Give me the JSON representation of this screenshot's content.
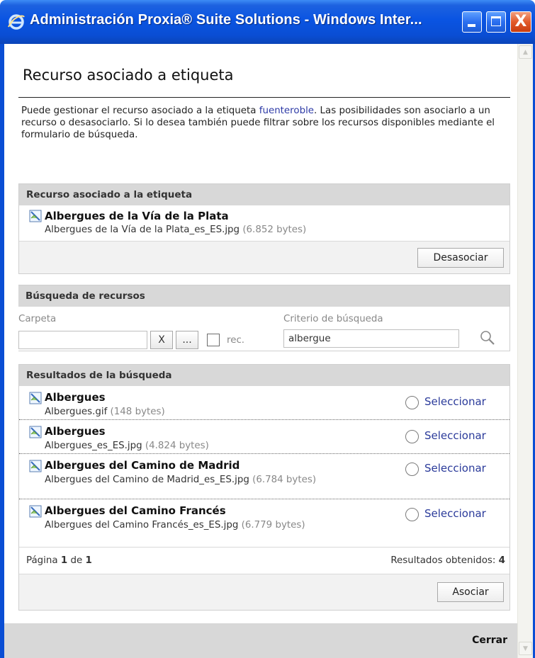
{
  "window": {
    "title": "Administración Proxia® Suite Solutions - Windows Inter...",
    "close_glyph": "X"
  },
  "page": {
    "heading": "Recurso asociado a etiqueta",
    "intro_prefix": "Puede gestionar el recurso asociado a la etiqueta ",
    "intro_tag": "fuenteroble",
    "intro_suffix": ". Las posibilidades son asociarlo a un recurso o desasociarlo. Si lo desea también puede filtrar sobre los recursos disponibles mediante el formulario de búsqueda."
  },
  "associated": {
    "header": "Recurso asociado a la etiqueta",
    "title": "Albergues de la Vía de la Plata",
    "filename": "Albergues de la Vía de la Plata_es_ES.jpg",
    "size": "(6.852 bytes)",
    "icon": "image-file-icon",
    "button": "Desasociar"
  },
  "search": {
    "header": "Búsqueda de recursos",
    "folder_label": "Carpeta",
    "folder_value": "",
    "clear_label": "X",
    "browse_label": "...",
    "recursive_label": "rec.",
    "recursive_checked": false,
    "criteria_label": "Criterio de búsqueda",
    "criteria_value": "albergue",
    "search_icon": "magnifier-icon"
  },
  "results": {
    "header": "Resultados de la búsqueda",
    "select_label": "Seleccionar",
    "items": [
      {
        "title": "Albergues",
        "filename": "Albergues.gif",
        "size": "(148 bytes)"
      },
      {
        "title": "Albergues",
        "filename": "Albergues_es_ES.jpg",
        "size": "(4.824 bytes)"
      },
      {
        "title": "Albergues del Camino de Madrid",
        "filename": "Albergues del Camino de Madrid_es_ES.jpg",
        "size": "(6.784 bytes)"
      },
      {
        "title": "Albergues del Camino Francés",
        "filename": "Albergues del Camino Francés_es_ES.jpg",
        "size": "(6.779 bytes)"
      }
    ],
    "pager_prefix": "Página",
    "pager_current": "1",
    "pager_of": "de",
    "pager_total": "1",
    "count_label": "Resultados obtenidos:",
    "count_value": "4",
    "button": "Asociar"
  },
  "footer": {
    "close_label": "Cerrar"
  },
  "colors": {
    "titlebar": "#0a54e2",
    "link": "#2d3aa6",
    "panel_header": "#d8d8d8"
  }
}
